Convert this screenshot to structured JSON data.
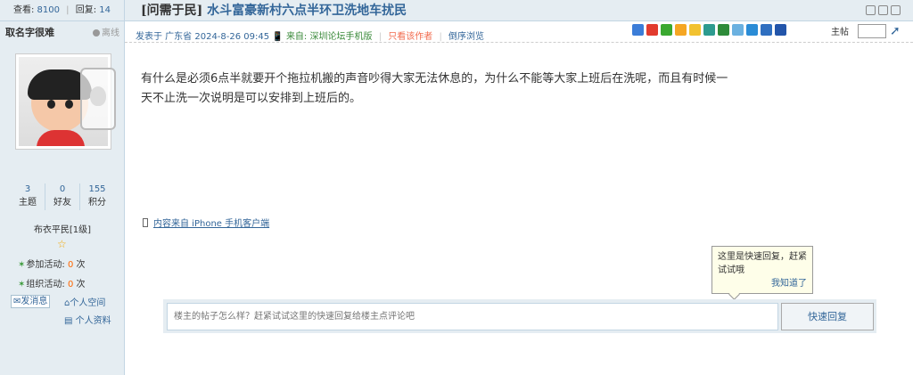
{
  "stats": {
    "views_label": "查看:",
    "views": "8100",
    "replies_label": "回复:",
    "replies": "14"
  },
  "thread": {
    "category": "[问需于民]",
    "title": "水斗富豪新村六点半环卫洗地车扰民"
  },
  "author": {
    "name": "取名字很难",
    "status": "离线",
    "threads": "3",
    "threads_label": "主题",
    "friends": "0",
    "friends_label": "好友",
    "points": "155",
    "points_label": "积分",
    "rank": "布衣平民[1级]"
  },
  "activity": {
    "joined_label": "参加活动:",
    "joined": "0",
    "organized_label": "组织活动:",
    "organized": "0",
    "unit": "次"
  },
  "links": {
    "message": "发消息",
    "space": "个人空间",
    "profile": "个人资料"
  },
  "post_meta": {
    "posted_at": "发表于 广东省 2024-8-26 09:45",
    "from_label": "来自:",
    "from": "深圳论坛手机版",
    "only_author": "只看该作者",
    "reverse": "倒序浏览"
  },
  "toolbar": {
    "louzhu": "主帖"
  },
  "content": {
    "text": "有什么是必须6点半就要开个拖拉机搬的声音吵得大家无法休息的，为什么不能等大家上班后在洗呢，而且有时候一天不止洗一次说明是可以安排到上班后的。",
    "client": "内容来自 iPhone 手机客户端"
  },
  "tooltip": {
    "text": "这里是快速回复，赶紧试试哦",
    "ok": "我知道了"
  },
  "quick_reply": {
    "placeholder": "楼主的帖子怎么样？赶紧试试这里的快速回复给楼主点评论吧",
    "button": "快速回复"
  }
}
